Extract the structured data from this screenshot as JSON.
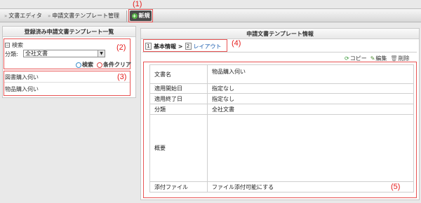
{
  "annotations": {
    "a1": "(1)",
    "a2": "(2)",
    "a3": "(3)",
    "a4": "(4)",
    "a5": "(5)"
  },
  "breadcrumb": {
    "item1": "文書エディタ",
    "item2": "申請文書テンプレート管理"
  },
  "new_button": "新規",
  "left_panel": {
    "title": "登録済み申請文書テンプレート一覧",
    "search_toggle": "検索",
    "category_label": "分類:",
    "category_value": "全社文書",
    "search_button": "検索",
    "clear_button": "条件クリア",
    "templates": [
      "図書購入伺い",
      "物品購入伺い"
    ]
  },
  "right_panel": {
    "title": "申請文書テンプレート情報",
    "tab1_num": "1",
    "tab1_label": "基本情報 >",
    "tab2_num": "2",
    "tab2_label": "レイアウト",
    "copy": "コピー",
    "edit": "編集",
    "delete": "削除",
    "fields": [
      {
        "label": "文書名",
        "value": "物品購入伺い"
      },
      {
        "label": "適用開始日",
        "value": "指定なし"
      },
      {
        "label": "適用終了日",
        "value": "指定なし"
      },
      {
        "label": "分類",
        "value": "全社文書"
      },
      {
        "label": "概要",
        "value": ""
      },
      {
        "label": "添付ファイル",
        "value": "ファイル添付可能にする"
      }
    ]
  }
}
